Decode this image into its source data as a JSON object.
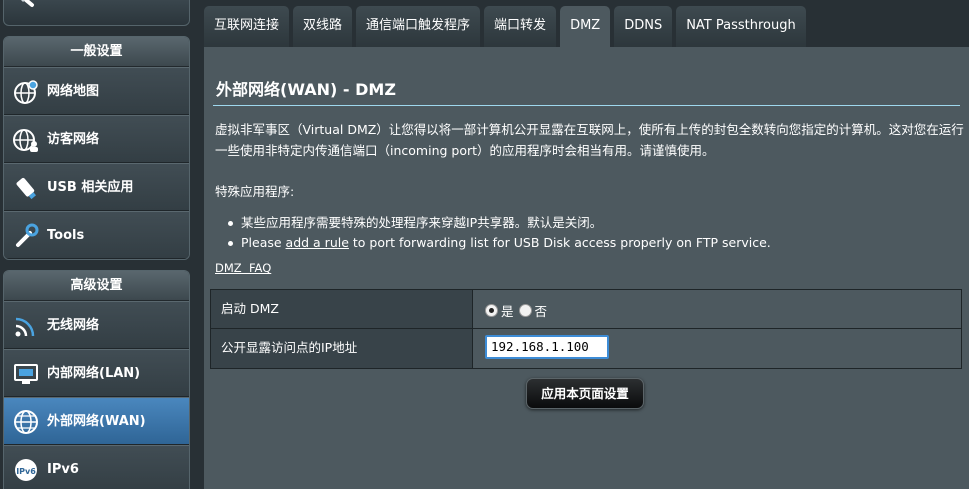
{
  "sidebar": {
    "general_header": "一般设置",
    "general_items": [
      {
        "label": "网络地图",
        "icon": "network-map-icon"
      },
      {
        "label": "访客网络",
        "icon": "guest-network-icon"
      },
      {
        "label": "USB 相关应用",
        "icon": "usb-icon"
      },
      {
        "label": "Tools",
        "icon": "wrench-icon"
      }
    ],
    "advanced_header": "高级设置",
    "advanced_items": [
      {
        "label": "无线网络",
        "icon": "wireless-icon"
      },
      {
        "label": "内部网络(LAN)",
        "icon": "lan-icon"
      },
      {
        "label": "外部网络(WAN)",
        "icon": "wan-globe-icon",
        "active": true
      },
      {
        "label": "IPv6",
        "icon": "ipv6-icon"
      }
    ]
  },
  "tabs": [
    "互联网连接",
    "双线路",
    "通信端口触发程序",
    "端口转发",
    "DMZ",
    "DDNS",
    "NAT Passthrough"
  ],
  "active_tab": "DMZ",
  "main": {
    "title": "外部网络(WAN) - DMZ",
    "description": "虚拟非军事区（Virtual DMZ）让您得以将一部计算机公开显露在互联网上，使所有上传的封包全数转向您指定的计算机。这对您在运行一些使用非特定内传通信端口（incoming port）的应用程序时会相当有用。请谨慎使用。",
    "special_label": "特殊应用程序:",
    "bullet_1": "某些应用程序需要特殊的处理程序来穿越IP共享器。默认是关闭。",
    "bullet_2_pre": "Please ",
    "bullet_2_link": "add a rule",
    "bullet_2_post": " to port forwarding list for USB Disk access properly on FTP service.",
    "faq_link": "DMZ  FAQ"
  },
  "form": {
    "enable_label": "启动 DMZ",
    "yes_label": "是",
    "no_label": "否",
    "enabled": true,
    "ip_label": "公开显露访问点的IP地址",
    "ip_value": "192.168.1.100"
  },
  "apply_button": "应用本页面设置",
  "colors": {
    "accent_blue": "#3d8cd6",
    "active_menu": "#2f6596",
    "panel": "#4d595f"
  }
}
